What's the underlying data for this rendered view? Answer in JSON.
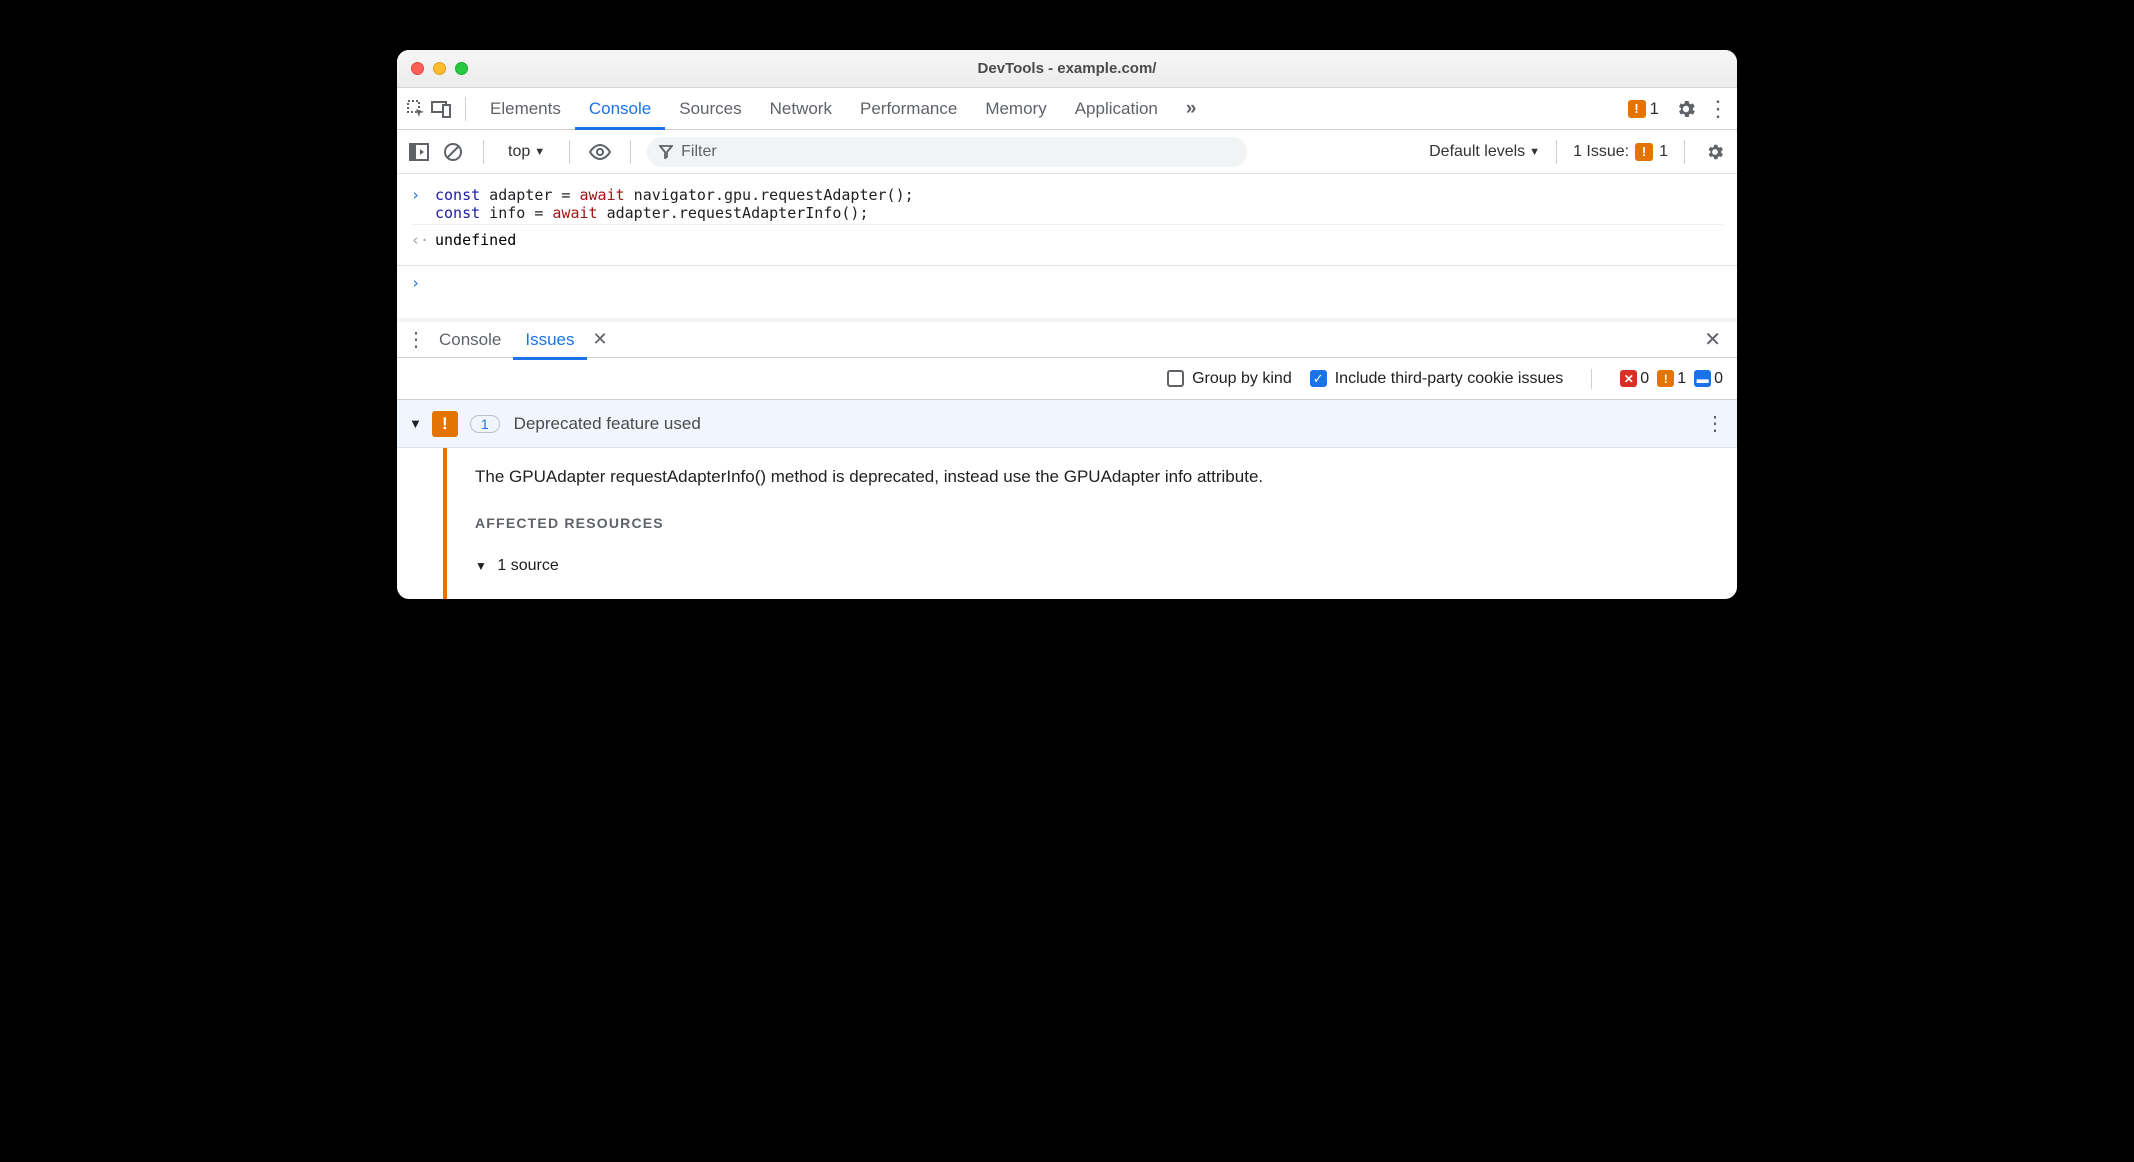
{
  "window": {
    "title": "DevTools - example.com/"
  },
  "toolbar": {
    "tabs": [
      "Elements",
      "Console",
      "Sources",
      "Network",
      "Performance",
      "Memory",
      "Application"
    ],
    "active_tab": "Console",
    "overflow_glyph": "»",
    "warn_count": "1"
  },
  "filterbar": {
    "context": "top",
    "filter_placeholder": "Filter",
    "levels_label": "Default levels",
    "issues_label": "1 Issue:",
    "issues_count": "1"
  },
  "console": {
    "input_line1_pre": "const",
    "input_line1_var": " adapter = ",
    "input_line1_await": "await",
    "input_line1_rest": " navigator.gpu.requestAdapter();",
    "input_line2_pre": "const",
    "input_line2_var": " info = ",
    "input_line2_await": "await",
    "input_line2_rest": " adapter.requestAdapterInfo();",
    "result": "undefined"
  },
  "drawer": {
    "tabs": [
      "Console",
      "Issues"
    ],
    "active": "Issues"
  },
  "issues_toolbar": {
    "group_by_kind_label": "Group by kind",
    "group_by_kind_checked": false,
    "include_3p_label": "Include third-party cookie issues",
    "include_3p_checked": true,
    "counts": {
      "error": "0",
      "warning": "1",
      "info": "0"
    }
  },
  "issue": {
    "badge_count": "1",
    "title": "Deprecated feature used",
    "description": "The GPUAdapter requestAdapterInfo() method is deprecated, instead use the GPUAdapter info attribute.",
    "section_label": "AFFECTED RESOURCES",
    "source_row": "1 source"
  }
}
